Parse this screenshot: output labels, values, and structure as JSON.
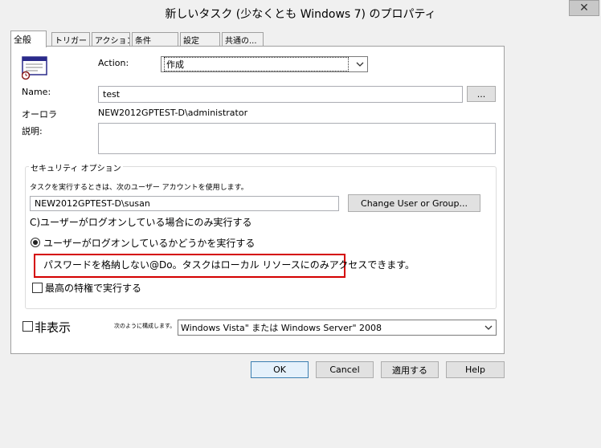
{
  "window": {
    "title": "新しいタスク (少なくとも Windows 7) のプロパティ"
  },
  "tabs": [
    {
      "label": "全般",
      "active": true
    },
    {
      "label": "トリガー"
    },
    {
      "label": "アクション"
    },
    {
      "label": "条件"
    },
    {
      "label": "設定"
    },
    {
      "label": "共通の..."
    }
  ],
  "general": {
    "action_label": "Action:",
    "action_value": "作成",
    "name_label": "Name:",
    "name_value": "test",
    "browse_label": "...",
    "author_label": "オーロラ",
    "author_value": "NEW2012GPTEST-D\\administrator",
    "description_label": "説明:",
    "description_value": ""
  },
  "security": {
    "title": "セキュリティ オプション",
    "run_as_text": "タスクを実行するときは、次のユーザー アカウントを使用します。",
    "user_value": "NEW2012GPTEST-D\\susan",
    "change_user_label": "Change User or Group...",
    "option_logged_on": "C)ユーザーがログオンしている場合にのみ実行する",
    "option_whether": "ユーザーがログオンしているかどうかを実行する",
    "no_password_text": "パスワードを格納しない@Do。タスクはローカル リソースにのみアクセスできます。",
    "highest_privileges": "最高の特権で実行する"
  },
  "bottom": {
    "hidden_label": "非表示",
    "configure_label": "次のように構成します。",
    "configure_value": "Windows Vista\" または Windows Server\" 2008"
  },
  "buttons": {
    "ok": "OK",
    "cancel": "Cancel",
    "apply": "適用する",
    "help": "Help"
  },
  "icons": {
    "close": "close-icon",
    "task": "task-icon",
    "dropdown": "chevron-down-icon"
  }
}
